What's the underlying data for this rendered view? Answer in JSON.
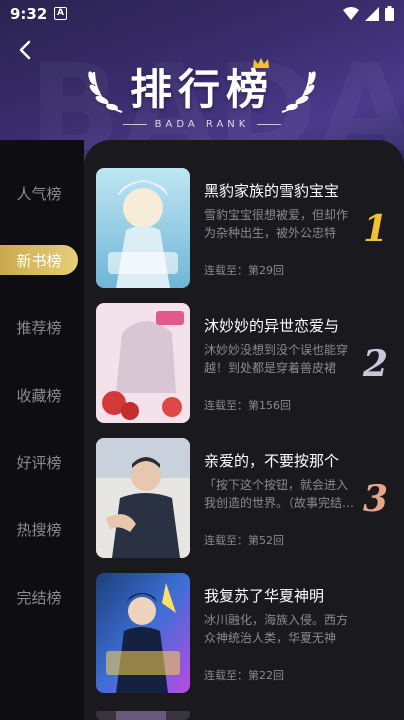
{
  "status_bar": {
    "time": "9:32",
    "notification_letter": "A"
  },
  "header": {
    "title": "排行榜",
    "subtitle": "BADA RANK",
    "bg_letters": "BADA"
  },
  "sidebar": {
    "items": [
      {
        "label": "人气榜",
        "active": false
      },
      {
        "label": "新书榜",
        "active": true
      },
      {
        "label": "推荐榜",
        "active": false
      },
      {
        "label": "收藏榜",
        "active": false
      },
      {
        "label": "好评榜",
        "active": false
      },
      {
        "label": "热搜榜",
        "active": false
      },
      {
        "label": "完结榜",
        "active": false
      }
    ]
  },
  "books": [
    {
      "rank": "1",
      "title": "黑豹家族的雪豹宝宝",
      "desc": "雪豹宝宝很想被爱，但却作为杂种出生，被外公忠特欺…",
      "update": "连载至：第29回"
    },
    {
      "rank": "2",
      "title": "沐妙妙的异世恋爱与",
      "desc": "沐妙妙没想到没个误也能穿越！到处都是穿着兽皮裙露…",
      "update": "连载至：第156回"
    },
    {
      "rank": "3",
      "title": "亲爱的，不要按那个",
      "desc": "「按下这个按钮，就会进入我创造的世界。（故事完结…",
      "update": "连载至：第52回"
    },
    {
      "rank": "",
      "title": "我复苏了华夏神明",
      "desc": "冰川融化，海族入侵。西方众神统治人类，华夏无神成…",
      "update": "连载至：第22回"
    }
  ],
  "colors": {
    "accent_gold": "#e7cf7a",
    "rank1": "#f0c233",
    "rank2": "#c9c5da",
    "rank3": "#e9a38d",
    "panel_bg": "#19191e",
    "header_purple": "#3a2d6e"
  }
}
